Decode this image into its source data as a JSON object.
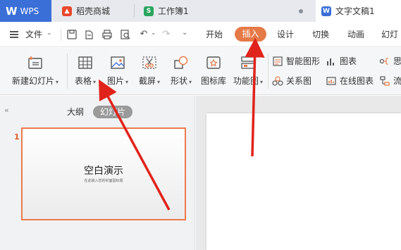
{
  "tabs": {
    "wps": "WPS",
    "daoke": "稻壳商城",
    "workbook": "工作簿1",
    "document": "文字文稿1"
  },
  "menu": {
    "file": "文件",
    "items": [
      "开始",
      "插入",
      "设计",
      "切换",
      "动画",
      "幻灯"
    ],
    "active": "插入"
  },
  "ribbon": {
    "new_slide": "新建幻灯片",
    "table": "表格",
    "picture": "图片",
    "screenshot": "截屏",
    "shape": "形状",
    "icon_lib": "图标库",
    "func_chart": "功能图",
    "smart_shape": "智能图形",
    "chart": "图表",
    "relation_chart": "关系图",
    "online_chart": "在线图表",
    "more1": "思",
    "more2": "流"
  },
  "left_panel": {
    "tab_outline": "大纲",
    "tab_slides": "幻灯片",
    "slide_number": "1",
    "slide_title": "空白演示",
    "slide_subtitle": "在此输入您的封面副标题"
  },
  "colors": {
    "accent": "#e67a47",
    "wps_blue": "#3a6fd8",
    "arrow_red": "#e0231b"
  }
}
